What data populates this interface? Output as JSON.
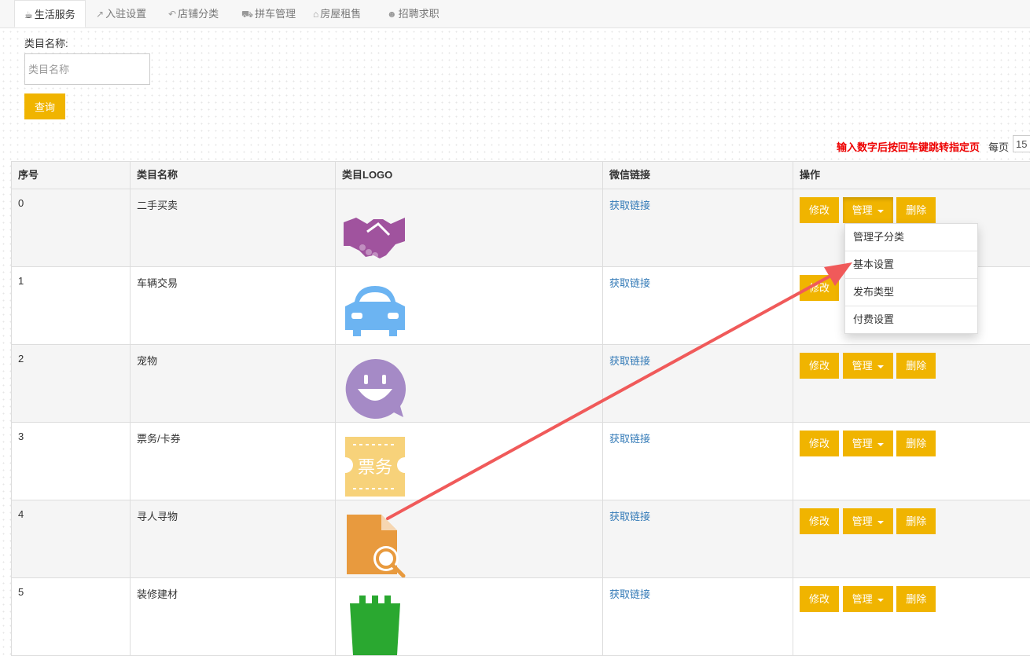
{
  "tabs": [
    {
      "label": "生活服务",
      "icon": "coffee-icon",
      "active": true
    },
    {
      "label": "入驻设置",
      "icon": "external-link-icon"
    },
    {
      "label": "店铺分类",
      "icon": "reply-icon"
    },
    {
      "label": "拼车管理",
      "icon": "truck-icon"
    },
    {
      "label": "房屋租售",
      "icon": "home-icon"
    },
    {
      "label": "招聘求职",
      "icon": "user-icon"
    }
  ],
  "search": {
    "label": "类目名称:",
    "placeholder": "类目名称",
    "button": "查询"
  },
  "pager": {
    "hint": "输入数字后按回车键跳转指定页",
    "per_page_label": "每页",
    "per_page_value": "15"
  },
  "table": {
    "headers": [
      "序号",
      "类目名称",
      "类目LOGO",
      "微信链接",
      "操作"
    ],
    "rows": [
      {
        "index": "0",
        "name": "二手买卖",
        "logo": "handshake-icon",
        "link": "获取链接"
      },
      {
        "index": "1",
        "name": "车辆交易",
        "logo": "car-icon",
        "link": "获取链接"
      },
      {
        "index": "2",
        "name": "宠物",
        "logo": "smile-chat-icon",
        "link": "获取链接"
      },
      {
        "index": "3",
        "name": "票务/卡券",
        "logo": "ticket-icon",
        "logo_text": "票务",
        "link": "获取链接"
      },
      {
        "index": "4",
        "name": "寻人寻物",
        "logo": "document-search-icon",
        "link": "获取链接"
      },
      {
        "index": "5",
        "name": "装修建材",
        "logo": "building-material-icon",
        "link": "获取链接"
      }
    ],
    "actions": {
      "edit": "修改",
      "manage": "管理",
      "delete": "删除"
    }
  },
  "dropdown": {
    "items": [
      "管理子分类",
      "基本设置",
      "发布类型",
      "付费设置"
    ]
  },
  "colors": {
    "accent": "#f0b400",
    "link": "#337ab7",
    "hint": "#e00000",
    "arrow": "#f05a5a",
    "handshake": "#a0539e",
    "car": "#6cb4f2",
    "smile": "#a58ac6",
    "ticket": "#f7d27a",
    "doc": "#e89a3e",
    "building": "#2aa830"
  }
}
